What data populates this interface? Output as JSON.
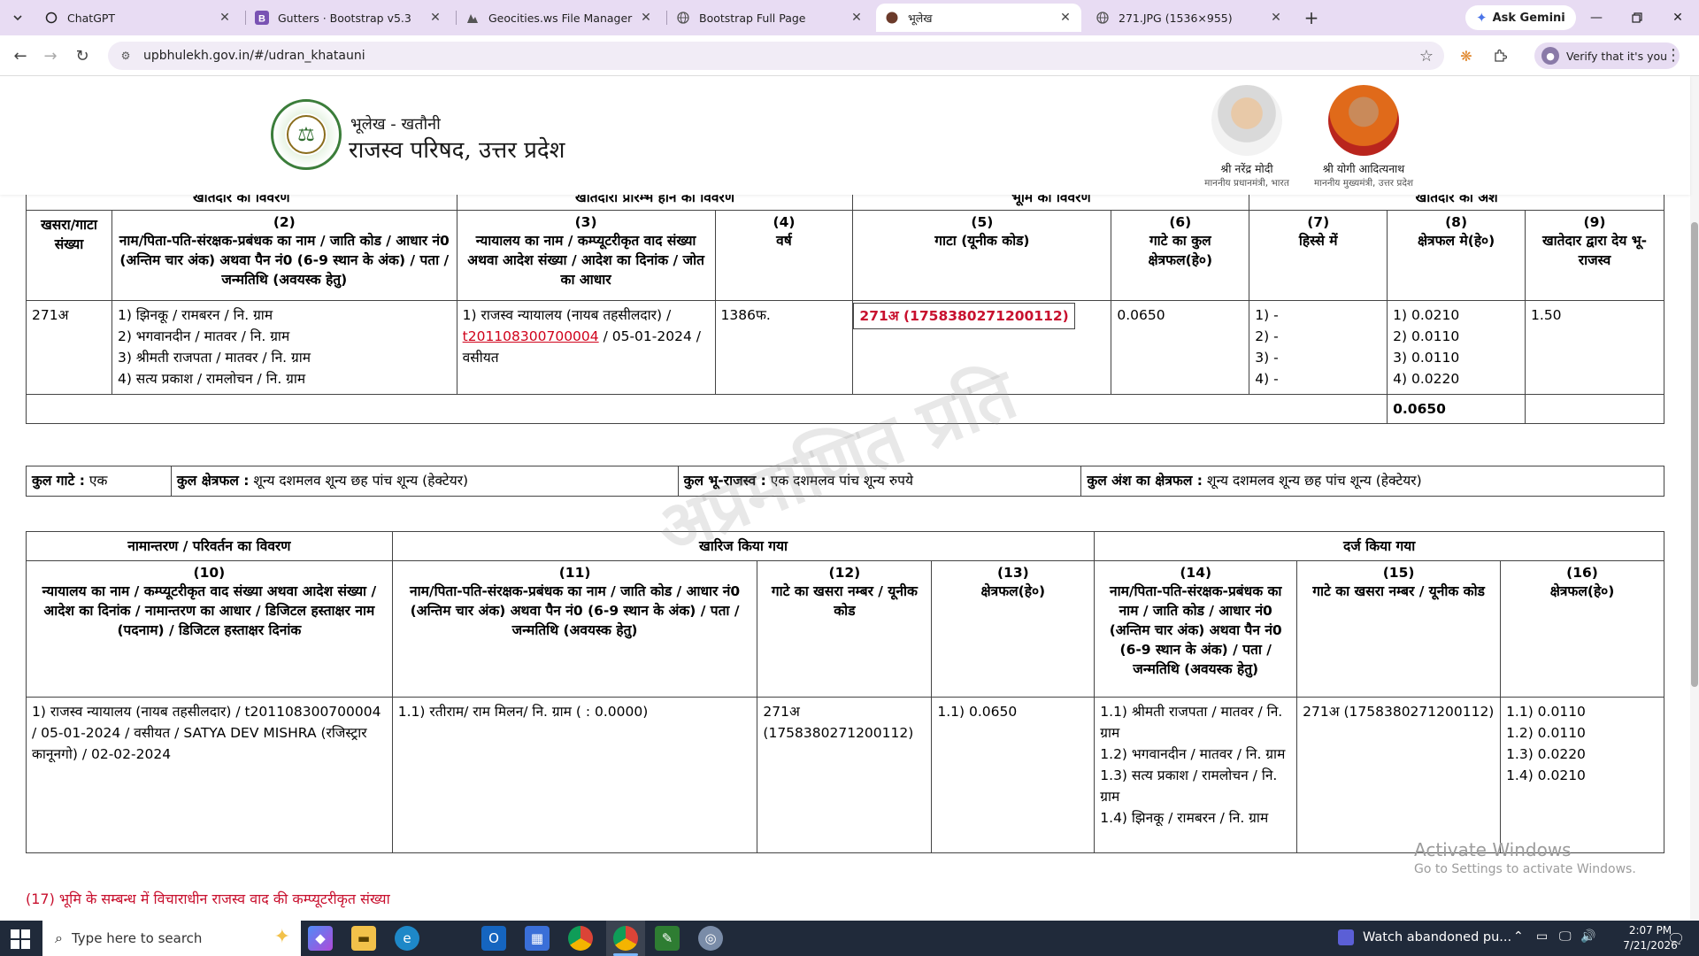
{
  "browser": {
    "tabs": [
      {
        "label": "ChatGPT",
        "icon": "chatgpt-icon",
        "active": false
      },
      {
        "label": "Gutters · Bootstrap v5.3",
        "icon": "bootstrap-icon",
        "active": false
      },
      {
        "label": "Geocities.ws File Manager",
        "icon": "geocities-icon",
        "active": false
      },
      {
        "label": "Bootstrap Full Page",
        "icon": "globe-icon",
        "active": false
      },
      {
        "label": "भूलेख",
        "icon": "bhulekh-icon",
        "active": true
      },
      {
        "label": "271.JPG (1536×955)",
        "icon": "globe-icon",
        "active": false
      }
    ],
    "ask_gemini": "Ask Gemini",
    "url": "upbhulekh.gov.in/#/udran_khatauni",
    "verify": "Verify that it's you"
  },
  "header": {
    "subtitle": "भूलेख - खतौनी",
    "title": "राजस्व परिषद, उत्तर प्रदेश",
    "leaders": [
      {
        "name": "श्री नरेंद्र मोदी",
        "title": "माननीय प्रधानमंत्री, भारत"
      },
      {
        "name": "श्री योगी आदित्यनाथ",
        "title": "माननीय मुख्यमंत्री, उत्तर प्रदेश"
      }
    ]
  },
  "table1": {
    "group_headers": [
      "खातेदार का विवरण",
      "खातेदारी प्रारम्भ होने का विवरण",
      "भूमि का विवरण",
      "खातेदार का अंश"
    ],
    "col_headers": [
      {
        "num": "",
        "text": "खसरा/गाटा संख्या"
      },
      {
        "num": "(2)",
        "text": "नाम/पिता-पति-संरक्षक-प्रबंधक का नाम / जाति कोड / आधार नं0 (अन्तिम चार अंक) अथवा पैन नं0 (6-9 स्थान के अंक) / पता / जन्मतिथि (अवयस्क हेतु)"
      },
      {
        "num": "(3)",
        "text": "न्यायालय का नाम / कम्प्यूटरीकृत वाद संख्या अथवा आदेश संख्या / आदेश का दिनांक / जोत का आधार"
      },
      {
        "num": "(4)",
        "text": "वर्ष"
      },
      {
        "num": "(5)",
        "text": "गाटा (यूनीक कोड)"
      },
      {
        "num": "(6)",
        "text": "गाटे का कुल क्षेत्रफल(हे०)"
      },
      {
        "num": "(7)",
        "text": "हिस्से में"
      },
      {
        "num": "(8)",
        "text": "क्षेत्रफल मे(हे०)"
      },
      {
        "num": "(9)",
        "text": "खातेदार द्वारा देय भू-राजस्व"
      }
    ],
    "row": {
      "khasra": "271अ",
      "names": [
        "1) झिनकू / रामबरन / नि. ग्राम",
        "2) भगवानदीन / मातवर / नि. ग्राम",
        "3) श्रीमती राजपता / मातवर / नि. ग्राम",
        "4) सत्य प्रकाश / रामलोचन / नि. ग्राम"
      ],
      "court_prefix": "1) राजस्व न्यायालय (नायब तहसीलदार) /",
      "court_link": "t201108300700004",
      "court_suffix": "/ 05-01-2024 /",
      "court_basis": "वसीयत",
      "year": "1386फ.",
      "gata": "271अ (1758380271200112)",
      "total_area": "0.0650",
      "share": [
        "1) -",
        "2) -",
        "3) -",
        "4) -"
      ],
      "area": [
        "1) 0.0210",
        "2) 0.0110",
        "3) 0.0110",
        "4) 0.0220"
      ],
      "revenue": "1.50"
    },
    "total": "0.0650"
  },
  "summary": [
    {
      "label": "कुल गाटे :",
      "value": "एक"
    },
    {
      "label": "कुल क्षेत्रफल :",
      "value": "शून्य दशमलव शून्य छह पांच शून्य (हेक्टेयर)"
    },
    {
      "label": "कुल भू-राजस्व :",
      "value": "एक दशमलव पांच शून्य रुपये"
    },
    {
      "label": "कुल अंश का क्षेत्रफल :",
      "value": "शून्य दशमलव शून्य छह पांच शून्य (हेक्टेयर)"
    }
  ],
  "table3": {
    "group_headers": [
      "नामान्तरण / परिवर्तन का विवरण",
      "खारिज किया गया",
      "दर्ज किया गया"
    ],
    "col_headers": [
      {
        "num": "(10)",
        "text": "न्यायालय का नाम / कम्प्यूटरीकृत वाद संख्या अथवा आदेश संख्या / आदेश का दिनांक / नामान्तरण का आधार / डिजिटल हस्ताक्षर नाम (पदनाम) / डिजिटल हस्ताक्षर दिनांक"
      },
      {
        "num": "(11)",
        "text": "नाम/पिता-पति-संरक्षक-प्रबंधक का नाम / जाति कोड / आधार नं0 (अन्तिम चार अंक) अथवा पैन नं0 (6-9 स्थान के अंक) / पता / जन्मतिथि (अवयस्क हेतु)"
      },
      {
        "num": "(12)",
        "text": "गाटे का खसरा नम्बर / यूनीक कोड"
      },
      {
        "num": "(13)",
        "text": "क्षेत्रफल(हे०)"
      },
      {
        "num": "(14)",
        "text": "नाम/पिता-पति-संरक्षक-प्रबंधक का नाम / जाति कोड / आधार नं0 (अन्तिम चार अंक) अथवा पैन नं0 (6-9 स्थान के अंक) / पता / जन्मतिथि (अवयस्क हेतु)"
      },
      {
        "num": "(15)",
        "text": "गाटे का खसरा नम्बर / यूनीक कोड"
      },
      {
        "num": "(16)",
        "text": "क्षेत्रफल(हे०)"
      }
    ],
    "row": {
      "c10": "1) राजस्व न्यायालय (नायब तहसीलदार) / t201108300700004 / 05-01-2024 / वसीयत / SATYA DEV MISHRA (रजिस्ट्रार कानूनगो) / 02-02-2024",
      "c11": "1.1) रतीराम/ राम मिलन/ नि. ग्राम ( : 0.0000)",
      "c12": "271अ (1758380271200112)",
      "c13": "1.1) 0.0650",
      "c14": [
        "1.1) श्रीमती राजपता / मातवर / नि. ग्राम",
        "1.2) भगवानदीन / मातवर / नि. ग्राम",
        "1.3) सत्य प्रकाश / रामलोचन / नि. ग्राम",
        "1.4) झिनकू / रामबरन / नि. ग्राम"
      ],
      "c15": "271अ (1758380271200112)",
      "c16": [
        "1.1) 0.0110",
        "1.2) 0.0110",
        "1.3) 0.0220",
        "1.4) 0.0210"
      ]
    }
  },
  "watermark": "अप्रमाणित प्रति",
  "activate": {
    "line1": "Activate Windows",
    "line2": "Go to Settings to activate Windows."
  },
  "note17": "(17) भूमि के सम्बन्ध में विचाराधीन राजस्व वाद की कम्प्यूटरीकृत संख्या",
  "taskbar": {
    "search_placeholder": "Type here to search",
    "news": "Watch abandoned pu...",
    "time": "2:07 PM",
    "date": "7/21/2026"
  }
}
